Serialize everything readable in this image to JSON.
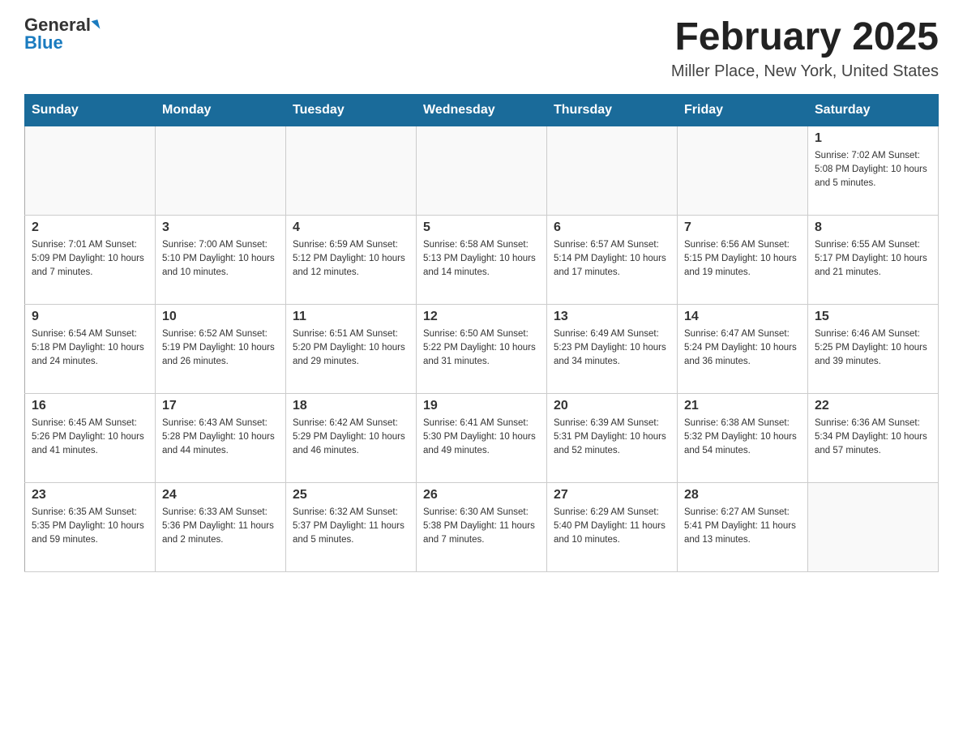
{
  "header": {
    "logo_general": "General",
    "logo_blue": "Blue",
    "month_title": "February 2025",
    "location": "Miller Place, New York, United States"
  },
  "days_of_week": [
    "Sunday",
    "Monday",
    "Tuesday",
    "Wednesday",
    "Thursday",
    "Friday",
    "Saturday"
  ],
  "weeks": [
    {
      "days": [
        {
          "num": "",
          "info": ""
        },
        {
          "num": "",
          "info": ""
        },
        {
          "num": "",
          "info": ""
        },
        {
          "num": "",
          "info": ""
        },
        {
          "num": "",
          "info": ""
        },
        {
          "num": "",
          "info": ""
        },
        {
          "num": "1",
          "info": "Sunrise: 7:02 AM\nSunset: 5:08 PM\nDaylight: 10 hours and 5 minutes."
        }
      ]
    },
    {
      "days": [
        {
          "num": "2",
          "info": "Sunrise: 7:01 AM\nSunset: 5:09 PM\nDaylight: 10 hours and 7 minutes."
        },
        {
          "num": "3",
          "info": "Sunrise: 7:00 AM\nSunset: 5:10 PM\nDaylight: 10 hours and 10 minutes."
        },
        {
          "num": "4",
          "info": "Sunrise: 6:59 AM\nSunset: 5:12 PM\nDaylight: 10 hours and 12 minutes."
        },
        {
          "num": "5",
          "info": "Sunrise: 6:58 AM\nSunset: 5:13 PM\nDaylight: 10 hours and 14 minutes."
        },
        {
          "num": "6",
          "info": "Sunrise: 6:57 AM\nSunset: 5:14 PM\nDaylight: 10 hours and 17 minutes."
        },
        {
          "num": "7",
          "info": "Sunrise: 6:56 AM\nSunset: 5:15 PM\nDaylight: 10 hours and 19 minutes."
        },
        {
          "num": "8",
          "info": "Sunrise: 6:55 AM\nSunset: 5:17 PM\nDaylight: 10 hours and 21 minutes."
        }
      ]
    },
    {
      "days": [
        {
          "num": "9",
          "info": "Sunrise: 6:54 AM\nSunset: 5:18 PM\nDaylight: 10 hours and 24 minutes."
        },
        {
          "num": "10",
          "info": "Sunrise: 6:52 AM\nSunset: 5:19 PM\nDaylight: 10 hours and 26 minutes."
        },
        {
          "num": "11",
          "info": "Sunrise: 6:51 AM\nSunset: 5:20 PM\nDaylight: 10 hours and 29 minutes."
        },
        {
          "num": "12",
          "info": "Sunrise: 6:50 AM\nSunset: 5:22 PM\nDaylight: 10 hours and 31 minutes."
        },
        {
          "num": "13",
          "info": "Sunrise: 6:49 AM\nSunset: 5:23 PM\nDaylight: 10 hours and 34 minutes."
        },
        {
          "num": "14",
          "info": "Sunrise: 6:47 AM\nSunset: 5:24 PM\nDaylight: 10 hours and 36 minutes."
        },
        {
          "num": "15",
          "info": "Sunrise: 6:46 AM\nSunset: 5:25 PM\nDaylight: 10 hours and 39 minutes."
        }
      ]
    },
    {
      "days": [
        {
          "num": "16",
          "info": "Sunrise: 6:45 AM\nSunset: 5:26 PM\nDaylight: 10 hours and 41 minutes."
        },
        {
          "num": "17",
          "info": "Sunrise: 6:43 AM\nSunset: 5:28 PM\nDaylight: 10 hours and 44 minutes."
        },
        {
          "num": "18",
          "info": "Sunrise: 6:42 AM\nSunset: 5:29 PM\nDaylight: 10 hours and 46 minutes."
        },
        {
          "num": "19",
          "info": "Sunrise: 6:41 AM\nSunset: 5:30 PM\nDaylight: 10 hours and 49 minutes."
        },
        {
          "num": "20",
          "info": "Sunrise: 6:39 AM\nSunset: 5:31 PM\nDaylight: 10 hours and 52 minutes."
        },
        {
          "num": "21",
          "info": "Sunrise: 6:38 AM\nSunset: 5:32 PM\nDaylight: 10 hours and 54 minutes."
        },
        {
          "num": "22",
          "info": "Sunrise: 6:36 AM\nSunset: 5:34 PM\nDaylight: 10 hours and 57 minutes."
        }
      ]
    },
    {
      "days": [
        {
          "num": "23",
          "info": "Sunrise: 6:35 AM\nSunset: 5:35 PM\nDaylight: 10 hours and 59 minutes."
        },
        {
          "num": "24",
          "info": "Sunrise: 6:33 AM\nSunset: 5:36 PM\nDaylight: 11 hours and 2 minutes."
        },
        {
          "num": "25",
          "info": "Sunrise: 6:32 AM\nSunset: 5:37 PM\nDaylight: 11 hours and 5 minutes."
        },
        {
          "num": "26",
          "info": "Sunrise: 6:30 AM\nSunset: 5:38 PM\nDaylight: 11 hours and 7 minutes."
        },
        {
          "num": "27",
          "info": "Sunrise: 6:29 AM\nSunset: 5:40 PM\nDaylight: 11 hours and 10 minutes."
        },
        {
          "num": "28",
          "info": "Sunrise: 6:27 AM\nSunset: 5:41 PM\nDaylight: 11 hours and 13 minutes."
        },
        {
          "num": "",
          "info": ""
        }
      ]
    }
  ]
}
